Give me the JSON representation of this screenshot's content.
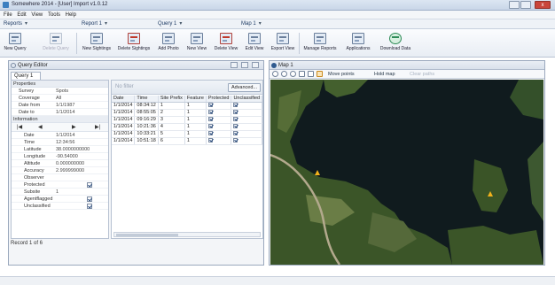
{
  "window": {
    "title": "Somewhere 2014 - [User] Import v1.0.12",
    "close_glyph": "x"
  },
  "menubar": [
    "File",
    "Edit",
    "View",
    "Tools",
    "Help"
  ],
  "ribbon_tabs": [
    {
      "label": "Reports"
    },
    {
      "label": "Report 1"
    },
    {
      "label": "Query 1"
    },
    {
      "label": "Map 1"
    }
  ],
  "toolbar": [
    {
      "label": "New Query",
      "icon": "new-query-icon",
      "enabled": true
    },
    {
      "label": "Delete Query",
      "icon": "delete-query-icon",
      "enabled": false
    },
    {
      "label": "New Sightings",
      "icon": "new-sightings-icon",
      "enabled": true
    },
    {
      "label": "Delete Sightings",
      "icon": "delete-sightings-icon",
      "enabled": true
    },
    {
      "label": "Add Photo",
      "icon": "add-photo-icon",
      "enabled": true
    },
    {
      "label": "New View",
      "icon": "new-view-icon",
      "enabled": true
    },
    {
      "label": "Delete View",
      "icon": "delete-view-icon",
      "enabled": true
    },
    {
      "label": "Edit View",
      "icon": "edit-view-icon",
      "enabled": true
    },
    {
      "label": "Export View",
      "icon": "export-view-icon",
      "enabled": true
    },
    {
      "label": "Manage Reports",
      "icon": "manage-reports-icon",
      "enabled": true
    },
    {
      "label": "Applications",
      "icon": "applications-icon",
      "enabled": true
    },
    {
      "label": "Download Data",
      "icon": "download-data-icon",
      "enabled": true
    }
  ],
  "left_panel": {
    "title": "Query Editor",
    "tab": "Query 1",
    "sections": {
      "properties": "Properties",
      "information": "Information"
    },
    "properties": [
      {
        "key": "Survey",
        "value": "Spots"
      },
      {
        "key": "Coverage",
        "value": "All"
      },
      {
        "key": "Date from",
        "value": "1/1/1987"
      },
      {
        "key": "Date to",
        "value": "1/1/2014"
      }
    ],
    "nav": {
      "first": "|◀",
      "prev": "◀",
      "next": "▶",
      "last": "▶|"
    },
    "record_fields": [
      {
        "key": "Date",
        "value": "1/1/2014",
        "type": "text"
      },
      {
        "key": "Time",
        "value": "12:34:56",
        "type": "text"
      },
      {
        "key": "Latitude",
        "value": "38.0000000000",
        "type": "text"
      },
      {
        "key": "Longitude",
        "value": "-90.54000",
        "type": "text"
      },
      {
        "key": "Altitude",
        "value": "0.000000000",
        "type": "text"
      },
      {
        "key": "Accuracy",
        "value": "2.999999000",
        "type": "text"
      },
      {
        "key": "Observer",
        "value": "",
        "type": "text"
      },
      {
        "key": "Protected",
        "value": "",
        "type": "check",
        "checked": true
      },
      {
        "key": "Subsite",
        "value": "1",
        "type": "text"
      },
      {
        "key": "Agentflagged",
        "value": "",
        "type": "check",
        "checked": true
      },
      {
        "key": "Unclassified",
        "value": "",
        "type": "check",
        "checked": true
      }
    ],
    "status": "Record 1 of 6"
  },
  "grid": {
    "filter_placeholder": "No filter",
    "advanced_button": "Advanced...",
    "columns": [
      "Date",
      "Time",
      "Site Prefix",
      "Feature",
      "Protected",
      "Unclassified"
    ],
    "rows": [
      {
        "date": "1/1/2014",
        "time": "08:34:12",
        "site": "1",
        "feature": "1",
        "protected": true,
        "unclassified": true
      },
      {
        "date": "1/1/2014",
        "time": "08:55:05",
        "site": "2",
        "feature": "1",
        "protected": true,
        "unclassified": true
      },
      {
        "date": "1/1/2014",
        "time": "09:16:29",
        "site": "3",
        "feature": "1",
        "protected": true,
        "unclassified": true
      },
      {
        "date": "1/1/2014",
        "time": "10:21:36",
        "site": "4",
        "feature": "1",
        "protected": true,
        "unclassified": true
      },
      {
        "date": "1/1/2014",
        "time": "10:33:21",
        "site": "5",
        "feature": "1",
        "protected": true,
        "unclassified": true
      },
      {
        "date": "1/1/2014",
        "time": "10:51:18",
        "site": "6",
        "feature": "1",
        "protected": true,
        "unclassified": true
      }
    ]
  },
  "map_panel": {
    "title": "Map 1",
    "tools": [
      {
        "icon": "pan-icon"
      },
      {
        "icon": "zoom-in-icon"
      },
      {
        "icon": "zoom-out-icon"
      },
      {
        "icon": "select-icon"
      },
      {
        "icon": "zoom-box-icon"
      },
      {
        "icon": "layers-icon"
      }
    ],
    "actions": [
      {
        "label": "Move points",
        "enabled": true
      },
      {
        "label": "Hold map",
        "enabled": true
      },
      {
        "label": "Clear paths",
        "enabled": false
      }
    ],
    "colors": {
      "water": "#0f1a1d",
      "land": "#3e5a2a",
      "land_light": "#6d7f4c",
      "marker": "#f2b21c"
    }
  }
}
